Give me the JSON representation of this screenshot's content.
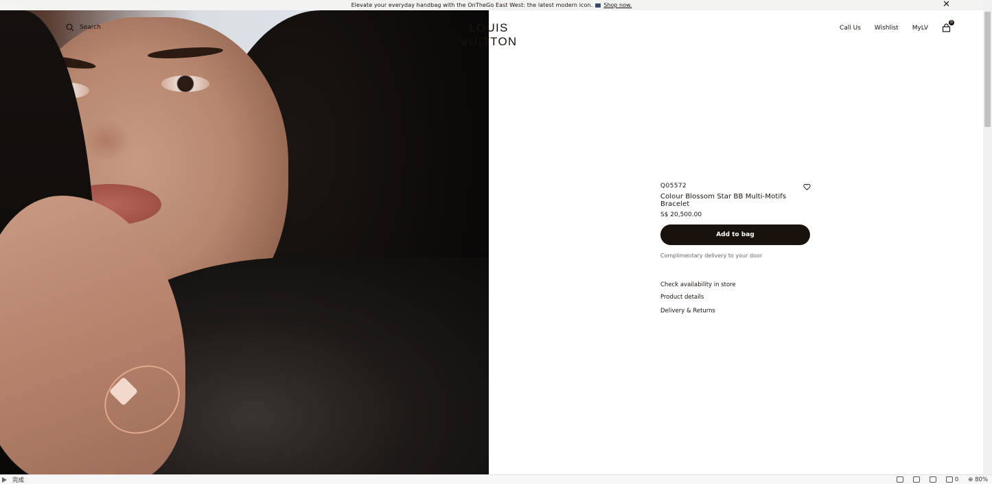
{
  "announcement": {
    "message": "Elevate your everyday handbag with the OnTheGo East West: the latest modern icon.",
    "cta": "Shop now."
  },
  "header": {
    "search_label": "Search",
    "logo": "LOUIS VUITTON",
    "nav": [
      "Call Us",
      "Wishlist",
      "MyLV"
    ],
    "bag_count": "0"
  },
  "product": {
    "sku": "Q05572",
    "name": "Colour Blossom Star BB Multi-Motifs Bracelet",
    "price": "S$ 20,500.00",
    "add_to_bag": "Add to bag",
    "delivery_note": "Complimentary delivery to your door",
    "links": [
      "Check availability in store",
      "Product details",
      "Delivery & Returns"
    ]
  },
  "statusbar": {
    "status_text": "完成",
    "counter": "0",
    "zoom": "80%"
  },
  "icons": [
    "search-icon",
    "heart-icon",
    "shopping-bag-icon",
    "close-icon",
    "play-icon"
  ]
}
